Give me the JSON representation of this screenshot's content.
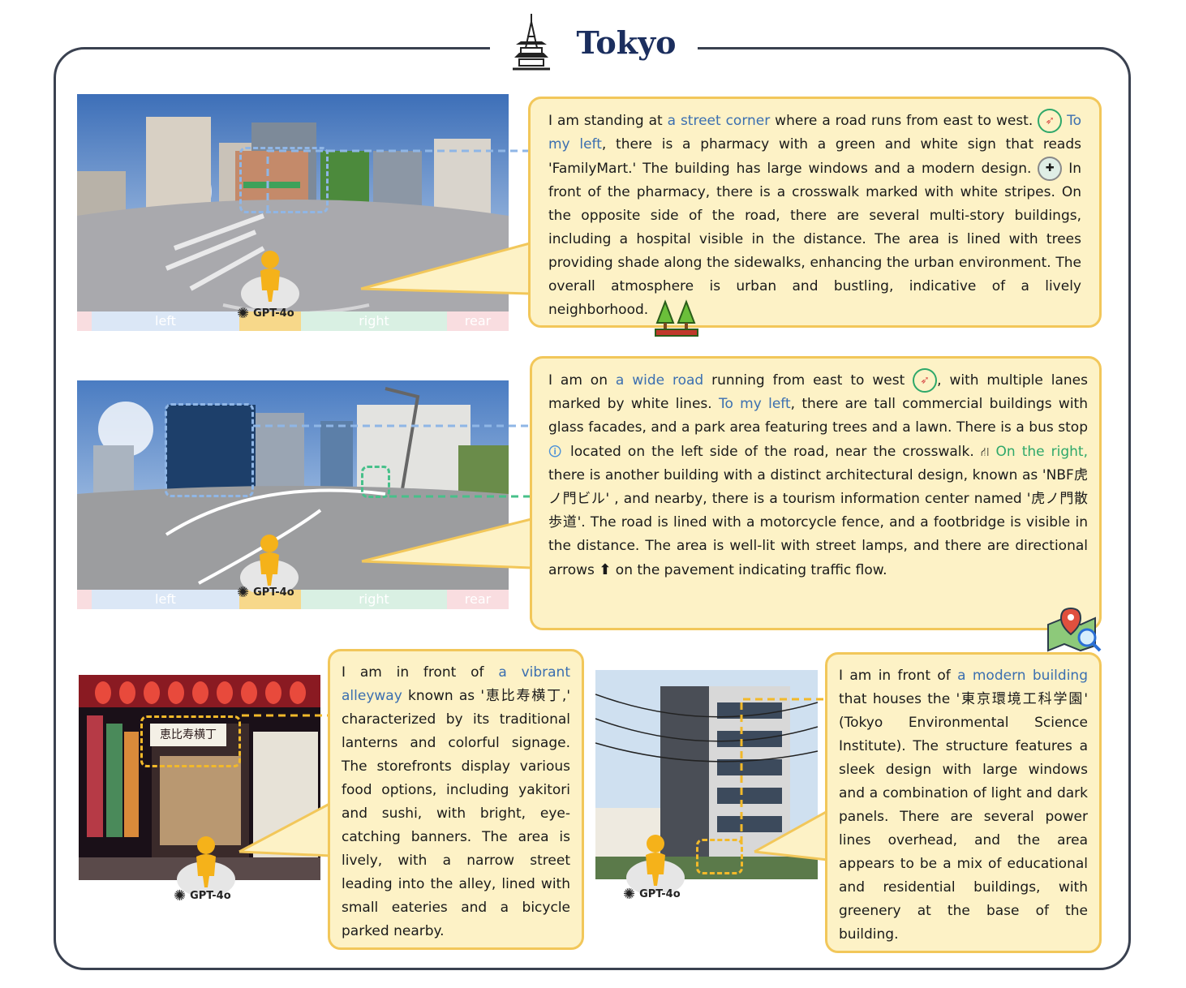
{
  "title": "Tokyo",
  "colors": {
    "frame": "#3a4150",
    "title": "#1b2e5e",
    "bubble_fill": "#fdf2c6",
    "bubble_border": "#f2c75a",
    "left_seg": "#dbe7f6",
    "front_seg": "#f7d88a",
    "right_seg": "#d9f0e3",
    "rear_seg": "#f9dde0",
    "blue_link": "#6f9fd8",
    "green_link": "#47c08a",
    "yellow_link": "#f2b92a"
  },
  "panel1": {
    "segments": {
      "left": "left",
      "right": "right",
      "rear": "rear"
    },
    "model": "GPT-4o",
    "text": {
      "t1": "I am standing at ",
      "h1": "a street corner",
      "t2": " where a road runs from east to west.",
      "h2": "To my left",
      "t3": ", there is a pharmacy with a green and white sign that reads 'FamilyMart.' The building has large windows and a modern design.",
      "t4": "In front of the pharmacy, there is a crosswalk marked with white stripes. On the opposite side of the road, there are several multi-story buildings, including a hospital visible in the distance. The area is lined with trees providing shade along the sidewalks, enhancing the urban environment. The overall atmosphere is urban and bustling, indicative of a lively neighborhood."
    },
    "icons": [
      "compass-icon",
      "pharmacy-icon",
      "trees-icon"
    ]
  },
  "panel2": {
    "segments": {
      "left": "left",
      "right": "right",
      "rear": "rear"
    },
    "model": "GPT-4o",
    "text": {
      "t1": "I am on ",
      "h1": "a wide road",
      "t2": " running from east to west",
      "t3": ", with multiple lanes marked by white lines.",
      "h2": "To my left",
      "t4": ", there are tall commercial buildings with glass facades, and a park area featuring trees and a lawn. There is a bus stop",
      "t5": " located on the left side of the road, near the crosswalk.",
      "h3": "On the right,",
      "t6": " there is another building with a distinct architectural design, known as 'NBF虎ノ門ビル' , and nearby, there is a tourism information center named '虎ノ門散歩道'. The road is lined with a motorcycle fence, and a footbridge is visible in the distance. The area is well-lit with street lamps, and there are directional arrows",
      "t7": " on the pavement indicating traffic flow."
    },
    "icons": [
      "compass-icon",
      "bus-stop-icon",
      "crosswalk-icon",
      "up-arrow-icon",
      "map-search-icon"
    ]
  },
  "panel3": {
    "model": "GPT-4o",
    "sign": "恵比寿横丁",
    "text": {
      "t1": "I am in front of ",
      "h1": "a vibrant alleyway",
      "t2": " known as '恵比寿横丁,' characterized by its traditional lanterns and colorful signage. The storefronts display various food options, including yakitori and sushi, with bright, eye-catching banners. The area is lively, with a narrow street leading into the alley, lined with small eateries and a bicycle parked nearby."
    }
  },
  "panel4": {
    "model": "GPT-4o",
    "text": {
      "t1": "I am in front of ",
      "h1": "a modern building",
      "t2": " that houses the '東京環境工科学園' (Tokyo Environmental Science Institute). The structure features a sleek design with large windows and a combination of light and dark panels. There are several power lines overhead, and the area appears to be a mix of educational and residential buildings, with greenery at the base of the building."
    }
  }
}
